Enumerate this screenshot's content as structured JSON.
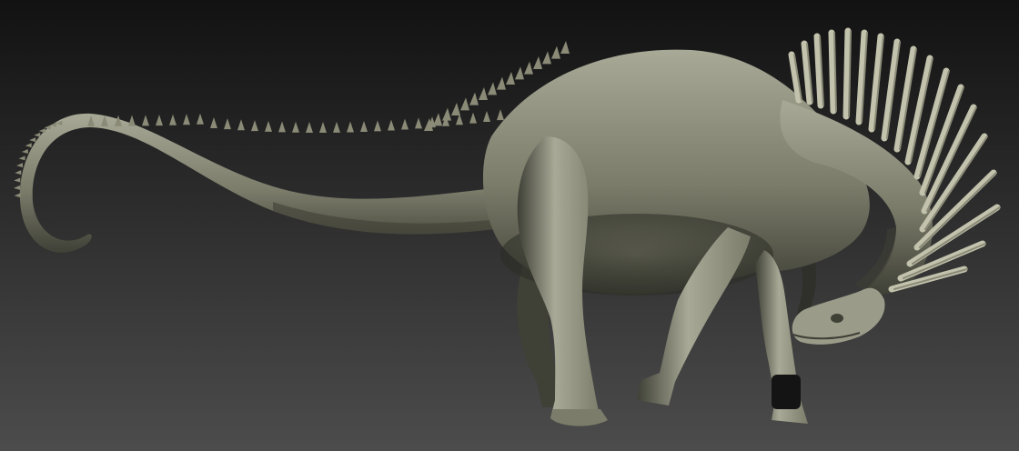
{
  "scene": {
    "subject": "sculpted-sauropod-model",
    "colors": {
      "bg_top": "#121212",
      "bg_bottom": "#4c4c4c",
      "skin_light": "#a8a996",
      "skin_mid": "#7b7c6a",
      "skin_dark": "#3f4036",
      "skin_shadow": "#2a2b24",
      "spine_light": "#c2c2ad",
      "spine_dark": "#8a8a77",
      "bandage": "#141414"
    }
  }
}
